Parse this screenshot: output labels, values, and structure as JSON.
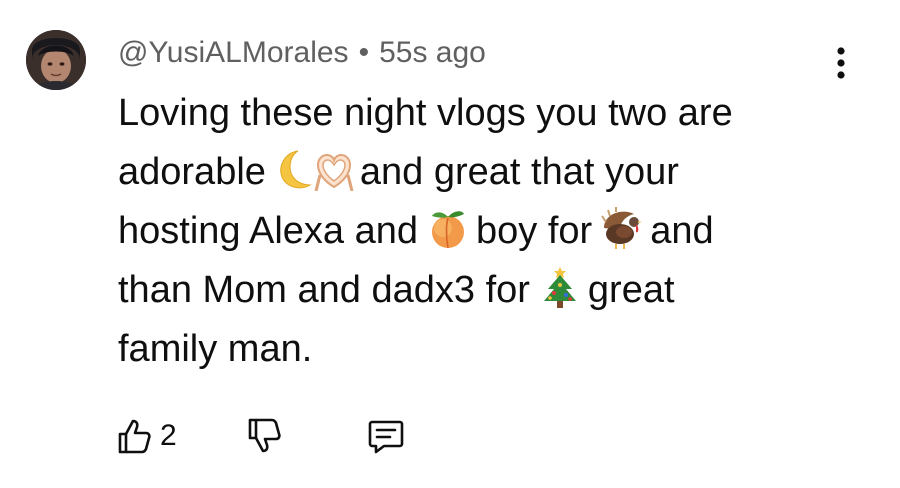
{
  "comment": {
    "author": "@YusiALMorales",
    "separator": "•",
    "time": "55s ago",
    "lines": [
      {
        "before": "Loving these night vlogs you two are",
        "after": ""
      },
      {
        "before": "adorable",
        "after": "and great that your"
      },
      {
        "before": "hosting Alexa and",
        "middle": "boy for",
        "after": "and"
      },
      {
        "before": "than Mom and dadx3 for",
        "after": "great"
      },
      {
        "before": "family man.",
        "after": ""
      }
    ],
    "emojis": [
      "crescent-moon-emoji",
      "heart-hands-emoji",
      "peach-emoji",
      "turkey-emoji",
      "christmas-tree-emoji"
    ]
  },
  "actions": {
    "like_count": "2",
    "like_icon": "thumbs-up-icon",
    "dislike_icon": "thumbs-down-icon",
    "reply_icon": "reply-comment-icon"
  },
  "menu_icon": "more-vertical-icon",
  "colors": {
    "text": "#0f0f0f",
    "secondary_text": "#606060",
    "background": "#ffffff"
  }
}
